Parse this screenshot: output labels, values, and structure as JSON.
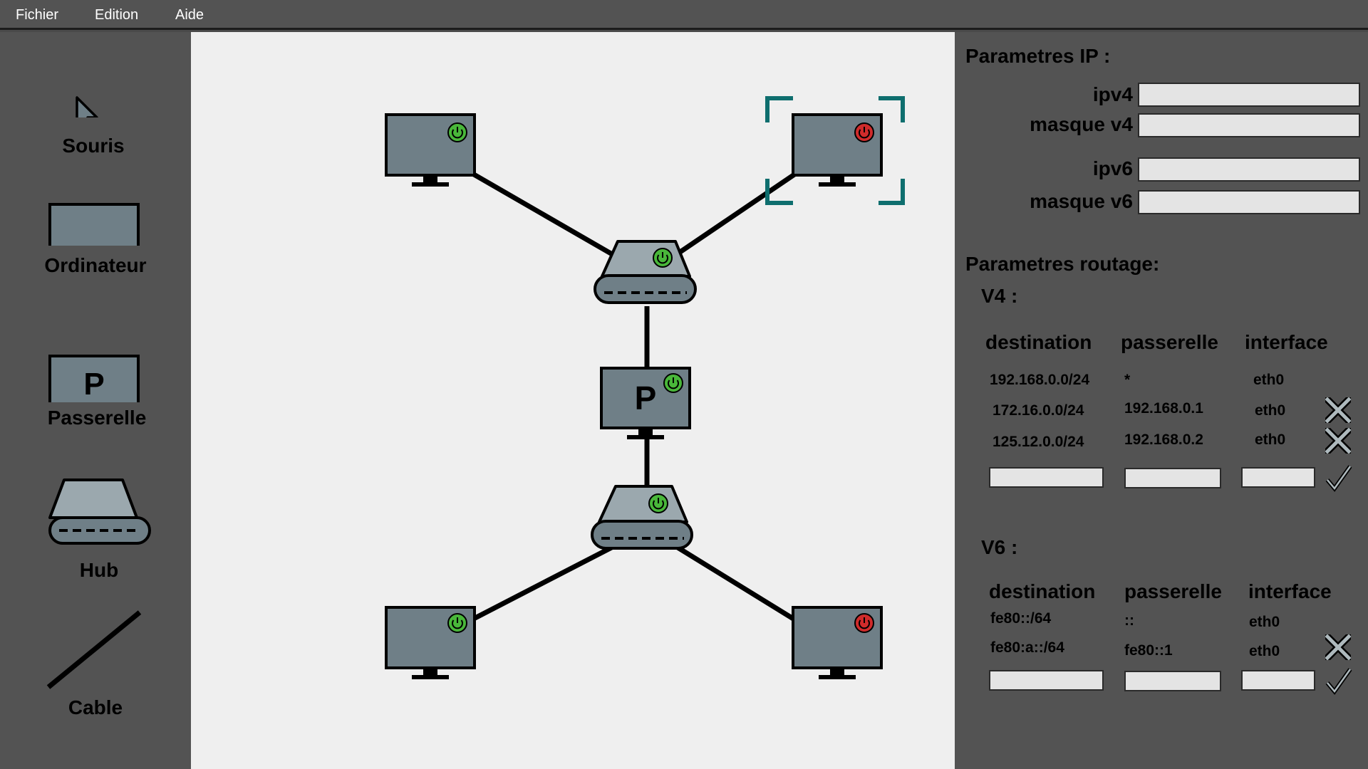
{
  "menu": {
    "file": "Fichier",
    "edit": "Edition",
    "help": "Aide"
  },
  "toolbox": {
    "mouse": "Souris",
    "computer": "Ordinateur",
    "gateway": "Passerelle",
    "gateway_letter": "P",
    "hub": "Hub",
    "cable": "Cable"
  },
  "canvas": {
    "gateway_letter": "P",
    "devices": [
      {
        "type": "computer",
        "status": "on"
      },
      {
        "type": "computer",
        "status": "off",
        "selected": true
      },
      {
        "type": "hub",
        "status": "on"
      },
      {
        "type": "gateway",
        "status": "on"
      },
      {
        "type": "hub",
        "status": "on"
      },
      {
        "type": "computer",
        "status": "on"
      },
      {
        "type": "computer",
        "status": "off"
      }
    ]
  },
  "ip": {
    "title": "Parametres IP :",
    "ipv4_label": "ipv4 :",
    "mask_v4_label": "masque v4 :",
    "ipv6_label": "ipv6 :",
    "mask_v6_label": "masque v6 :",
    "ipv4": "",
    "mask_v4": "",
    "ipv6": "",
    "mask_v6": ""
  },
  "routing": {
    "title": "Parametres routage:",
    "v4": {
      "title": "V4 :",
      "headers": [
        "destination",
        "passerelle",
        "interface"
      ],
      "rows": [
        {
          "destination": "192.168.0.0/24",
          "gateway": "*",
          "interface": "eth0"
        },
        {
          "destination": "172.16.0.0/24",
          "gateway": "192.168.0.1",
          "interface": "eth0"
        },
        {
          "destination": "125.12.0.0/24",
          "gateway": "192.168.0.2",
          "interface": "eth0"
        }
      ]
    },
    "v6": {
      "title": "V6 :",
      "headers": [
        "destination",
        "passerelle",
        "interface"
      ],
      "rows": [
        {
          "destination": "fe80::/64",
          "gateway": "::",
          "interface": "eth0"
        },
        {
          "destination": "fe80:a::/64",
          "gateway": "fe80::1",
          "interface": "eth0"
        }
      ]
    }
  },
  "colors": {
    "device": "#6f7f87",
    "hub_top": "#9ba8ae",
    "power_on": "#49b73a",
    "power_off": "#cf2b2b",
    "selection": "#0e6e6e"
  },
  "icons": {
    "power": "power-icon",
    "delete": "x-icon",
    "confirm": "checkmark-icon",
    "cursor": "cursor-arrow-icon"
  }
}
